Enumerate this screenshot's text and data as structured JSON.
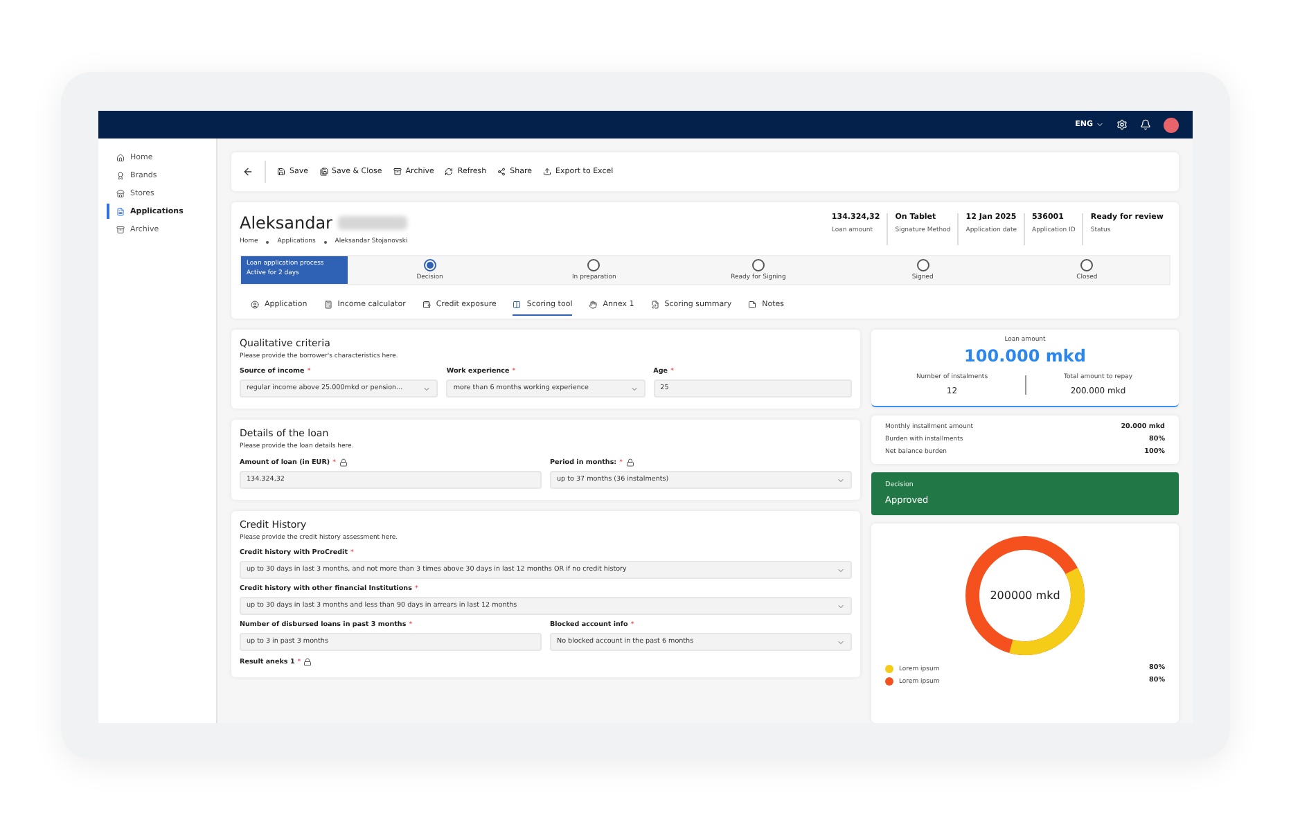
{
  "topbar": {
    "language": "ENG"
  },
  "sidebar": {
    "items": [
      {
        "label": "Home",
        "selected": false
      },
      {
        "label": "Brands",
        "selected": false
      },
      {
        "label": "Stores",
        "selected": false
      },
      {
        "label": "Applications",
        "selected": true
      },
      {
        "label": "Archive",
        "selected": false
      }
    ]
  },
  "toolbar": {
    "actions": [
      "Save",
      "Save & Close",
      "Archive",
      "Refresh",
      "Share",
      "Export to Excel"
    ]
  },
  "header": {
    "first_name": "Aleksandar",
    "breadcrumb": [
      "Home",
      "Applications",
      "Aleksandar Stojanovski"
    ],
    "facts": [
      {
        "value": "134.324,32",
        "label": "Loan amount"
      },
      {
        "value": "On Tablet",
        "label": "Signature Method"
      },
      {
        "value": "12 Jan 2025",
        "label": "Application date"
      },
      {
        "value": "536001",
        "label": "Application ID"
      },
      {
        "value": "Ready for review",
        "label": "Status"
      }
    ]
  },
  "process": {
    "title": "Loan application process",
    "subtitle": "Active for 2 days",
    "steps": [
      {
        "label": "Decision",
        "selected": true
      },
      {
        "label": "In preparation",
        "selected": false
      },
      {
        "label": "Ready for Signing",
        "selected": false
      },
      {
        "label": "Signed",
        "selected": false
      },
      {
        "label": "Closed",
        "selected": false
      }
    ]
  },
  "tabs": [
    {
      "label": "Application",
      "selected": false
    },
    {
      "label": "Income calculator",
      "selected": false
    },
    {
      "label": "Credit exposure",
      "selected": false
    },
    {
      "label": "Scoring tool",
      "selected": true
    },
    {
      "label": "Annex 1",
      "selected": false
    },
    {
      "label": "Scoring summary",
      "selected": false
    },
    {
      "label": "Notes",
      "selected": false
    }
  ],
  "sections": [
    {
      "title": "Qualitative criteria",
      "description": "Please provide the borrower's characteristics here.",
      "rows": [
        [
          {
            "label": "Source of income",
            "marker": "*",
            "locked": false,
            "kind": "select",
            "value": "regular income above 25.000mkd or pension..."
          },
          {
            "label": "Work experience",
            "marker": "*",
            "locked": false,
            "kind": "select",
            "value": "more than 6 months working experience"
          },
          {
            "label": "Age",
            "marker": "*",
            "locked": false,
            "kind": "input",
            "value": "25"
          }
        ]
      ]
    },
    {
      "title": "Details of the loan",
      "description": "Please provide the loan details here.",
      "rows": [
        [
          {
            "label": "Amount of loan (in EUR)",
            "marker": "*",
            "locked": true,
            "kind": "input",
            "value": "134.324,32"
          },
          {
            "label": "Period in months:",
            "marker": "*",
            "locked": true,
            "kind": "select",
            "value": "up to 37 months (36 instalments)"
          }
        ]
      ]
    },
    {
      "title": "Credit History",
      "description": "Please provide the credit history assessment here.",
      "rows": [
        [
          {
            "label": "Credit history with ProCredit",
            "marker": "*",
            "locked": false,
            "kind": "select",
            "value": "up to 30 days in last 3 months, and not more than 3 times above 30 days in last 12 months OR if no credit history"
          }
        ],
        [
          {
            "label": "Credit history with other financial Institutions",
            "marker": "*",
            "locked": false,
            "kind": "select",
            "value": "up to 30 days in last 3 months and less than 90 days in arrears in last 12 months"
          }
        ],
        [
          {
            "label": "Number of disbursed loans in past 3 months",
            "marker": "*",
            "locked": false,
            "kind": "input",
            "value": "up to 3  in past 3 months"
          },
          {
            "label": "Blocked account info",
            "marker": "*",
            "locked": false,
            "kind": "select",
            "value": "No blocked account in the past 6 months"
          }
        ],
        [
          {
            "label": "Result aneks 1",
            "marker": "*",
            "locked": true,
            "kind": "label"
          }
        ]
      ]
    }
  ],
  "loan_summary": {
    "label": "Loan amount",
    "amount": "100.000 mkd",
    "installments_label": "Number of instalments",
    "installments": "12",
    "total_label": "Total amount to repay",
    "total": "200.000 mkd"
  },
  "burden": [
    {
      "label": "Monthly installment amount",
      "value": "20.000 mkd"
    },
    {
      "label": "Burden with installments",
      "value": "80%"
    },
    {
      "label": "Net balance burden",
      "value": "100%"
    }
  ],
  "decision": {
    "label": "Decision",
    "value": "Approved"
  },
  "donut": {
    "center": "200000 mkd",
    "legend": [
      {
        "label": "Lorem ipsum",
        "value": "80%",
        "color": "#f5cc18"
      },
      {
        "label": "Lorem ipsum",
        "value": "80%",
        "color": "#f4511e"
      }
    ]
  }
}
